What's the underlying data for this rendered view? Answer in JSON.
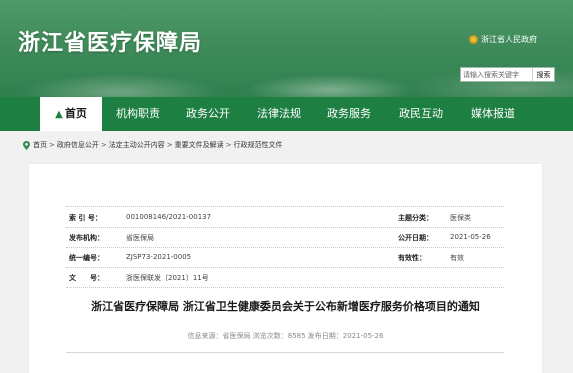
{
  "header": {
    "site_title": "浙江省医疗保障局",
    "gov_link": "浙江省人民政府",
    "search": {
      "placeholder": "请输入搜索关键字",
      "button_label": "搜索"
    }
  },
  "nav": {
    "items": [
      {
        "label": "首页",
        "active": true
      },
      {
        "label": "机构职责"
      },
      {
        "label": "政务公开"
      },
      {
        "label": "法律法规"
      },
      {
        "label": "政务服务"
      },
      {
        "label": "政民互动"
      },
      {
        "label": "媒体报道"
      }
    ]
  },
  "breadcrumb": [
    "首页",
    "政府信息公开",
    "法定主动公开内容",
    "重要文件及解读",
    "行政规范性文件"
  ],
  "meta": {
    "rows": [
      {
        "label": "索 引 号：",
        "value": "001008146/2021-00137",
        "label2": "主题分类：",
        "value2": "医保类"
      },
      {
        "label": "发布机构：",
        "value": "省医保局",
        "label2": "公开日期：",
        "value2": "2021-05-26"
      },
      {
        "label": "统一编号：",
        "value": "ZJSP73-2021-0005",
        "label2": "有效性：",
        "value2": "有效"
      },
      {
        "label": "文　　号：",
        "value": "浙医保联发〔2021〕11号",
        "label2": "",
        "value2": ""
      }
    ]
  },
  "document": {
    "title": "浙江省医疗保障局 浙江省卫生健康委员会关于公布新增医疗服务价格项目的通知",
    "source_line": "信息来源：省医保局  浏览次数：8585  发布日期：2021-05-26"
  },
  "colors": {
    "nav_green": "#1e7f42",
    "banner_green": "#3f8c5a"
  }
}
